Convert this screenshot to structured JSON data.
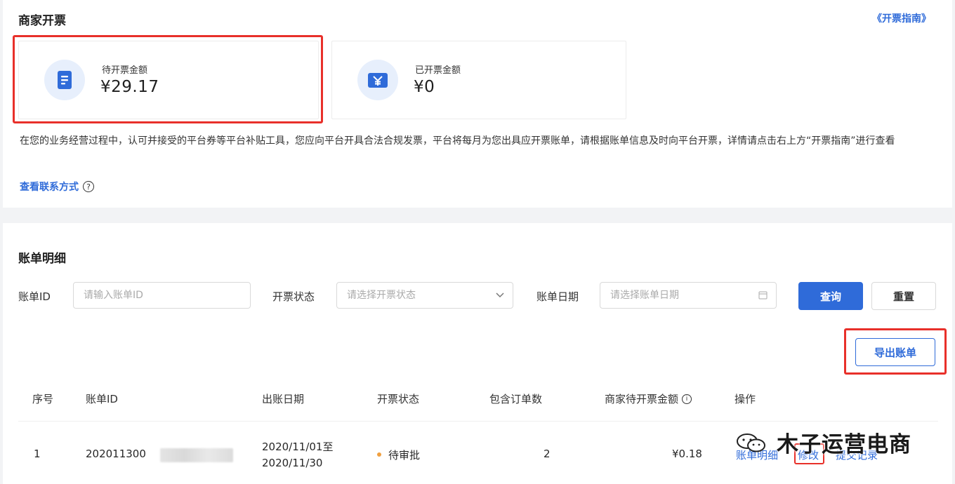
{
  "header": {
    "title": "商家开票",
    "guide_link": "《开票指南》"
  },
  "cards": {
    "pending": {
      "label": "待开票金额",
      "amount": "¥29.17"
    },
    "issued": {
      "label": "已开票金额",
      "amount": "¥0"
    }
  },
  "description": "在您的业务经营过程中，认可并接受的平台券等平台补贴工具，您应向平台开具合法合规发票，平台将每月为您出具应开票账单，请根据账单信息及时向平台开票，详情请点击右上方“开票指南”进行查看",
  "contact_link": "查看联系方式",
  "bill_section": {
    "title": "账单明细",
    "filters": {
      "bill_id_label": "账单ID",
      "bill_id_placeholder": "请输入账单ID",
      "status_label": "开票状态",
      "status_placeholder": "请选择开票状态",
      "date_label": "账单日期",
      "date_placeholder": "请选择账单日期"
    },
    "query_button": "查询",
    "reset_button": "重置",
    "export_button": "导出账单",
    "columns": [
      "序号",
      "账单ID",
      "出账日期",
      "开票状态",
      "包含订单数",
      "商家待开票金额",
      "操作"
    ],
    "rows": [
      {
        "index": "1",
        "bill_id": "202011300",
        "date_start": "2020/11/01至",
        "date_end": "2020/11/30",
        "status": "待审批",
        "order_count": "2",
        "amount": "¥0.18",
        "actions": [
          "账单明细",
          "修改",
          "提交记录"
        ]
      }
    ]
  },
  "watermark": "木子运营电商",
  "colors": {
    "accent": "#2f6bd9",
    "highlight": "#e8302a",
    "pending_dot": "#f0a040"
  }
}
